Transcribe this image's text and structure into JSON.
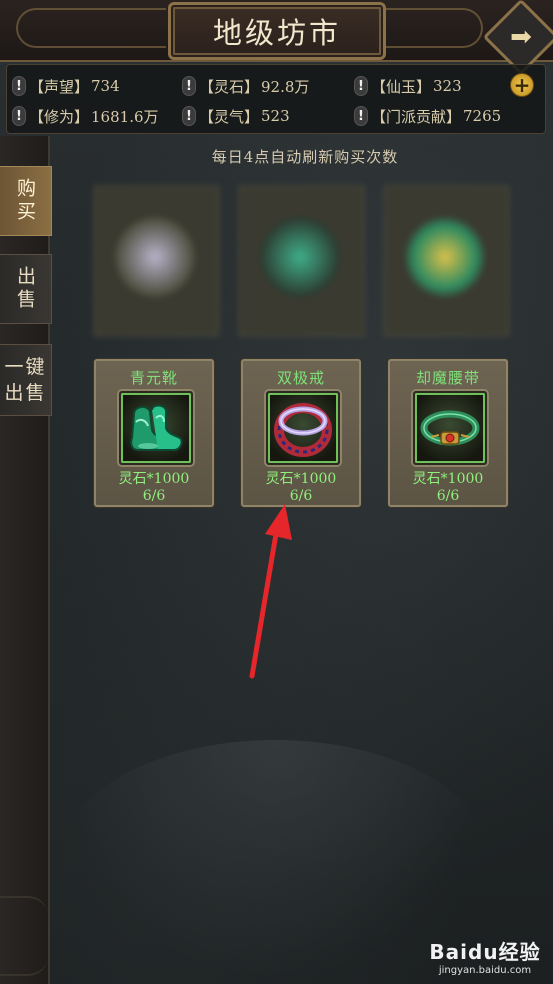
{
  "header": {
    "title": "地级坊市",
    "back_icon": "arrow-right-icon"
  },
  "resources": [
    {
      "label": "【声望】",
      "value": "734"
    },
    {
      "label": "【灵石】",
      "value": "92.8万"
    },
    {
      "label": "【仙玉】",
      "value": "323"
    },
    {
      "label": "【修为】",
      "value": "1681.6万"
    },
    {
      "label": "【灵气】",
      "value": "523"
    },
    {
      "label": "【门派贡献】",
      "value": "7265"
    }
  ],
  "resource_icon": "!",
  "add_currency_glyph": "+",
  "sidebar": {
    "buy": "购买",
    "sell": "出售",
    "one_click_sell_line1": "一键",
    "one_click_sell_line2": "出售"
  },
  "notice": "每日4点自动刷新购买次数",
  "items": [
    {
      "name": "青元靴",
      "price": "灵石*1000",
      "stock": "6/6",
      "icon": "boots-icon"
    },
    {
      "name": "双极戒",
      "price": "灵石*1000",
      "stock": "6/6",
      "icon": "ring-icon"
    },
    {
      "name": "却魔腰带",
      "price": "灵石*1000",
      "stock": "6/6",
      "icon": "belt-icon"
    }
  ],
  "colors": {
    "item_name": "#7fe07a",
    "price": "#8ff07e",
    "annotation_arrow": "#e5262b",
    "active_tab": "#8b6f44"
  },
  "watermark": {
    "brand": "Baidu经验",
    "url": "jingyan.baidu.com"
  }
}
